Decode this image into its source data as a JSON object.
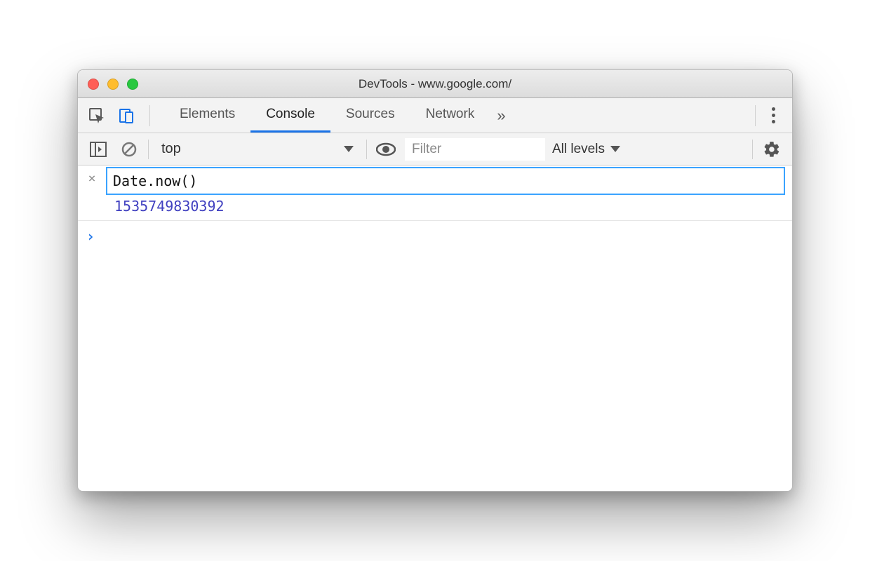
{
  "window": {
    "title": "DevTools - www.google.com/"
  },
  "tabs": {
    "items": [
      "Elements",
      "Console",
      "Sources",
      "Network"
    ],
    "active": "Console",
    "more": "»"
  },
  "console_toolbar": {
    "context": "top",
    "filter_placeholder": "Filter",
    "levels_label": "All levels"
  },
  "console": {
    "expression": "Date.now()",
    "result": "1535749830392",
    "prompt": "›"
  },
  "icons": {
    "inspect": "inspect-icon",
    "device": "device-icon",
    "kebab": "kebab-icon",
    "sidebar_toggle": "sidebar-toggle-icon",
    "clear": "clear-icon",
    "eye": "eye-icon",
    "gear": "gear-icon",
    "close_x": "×"
  }
}
